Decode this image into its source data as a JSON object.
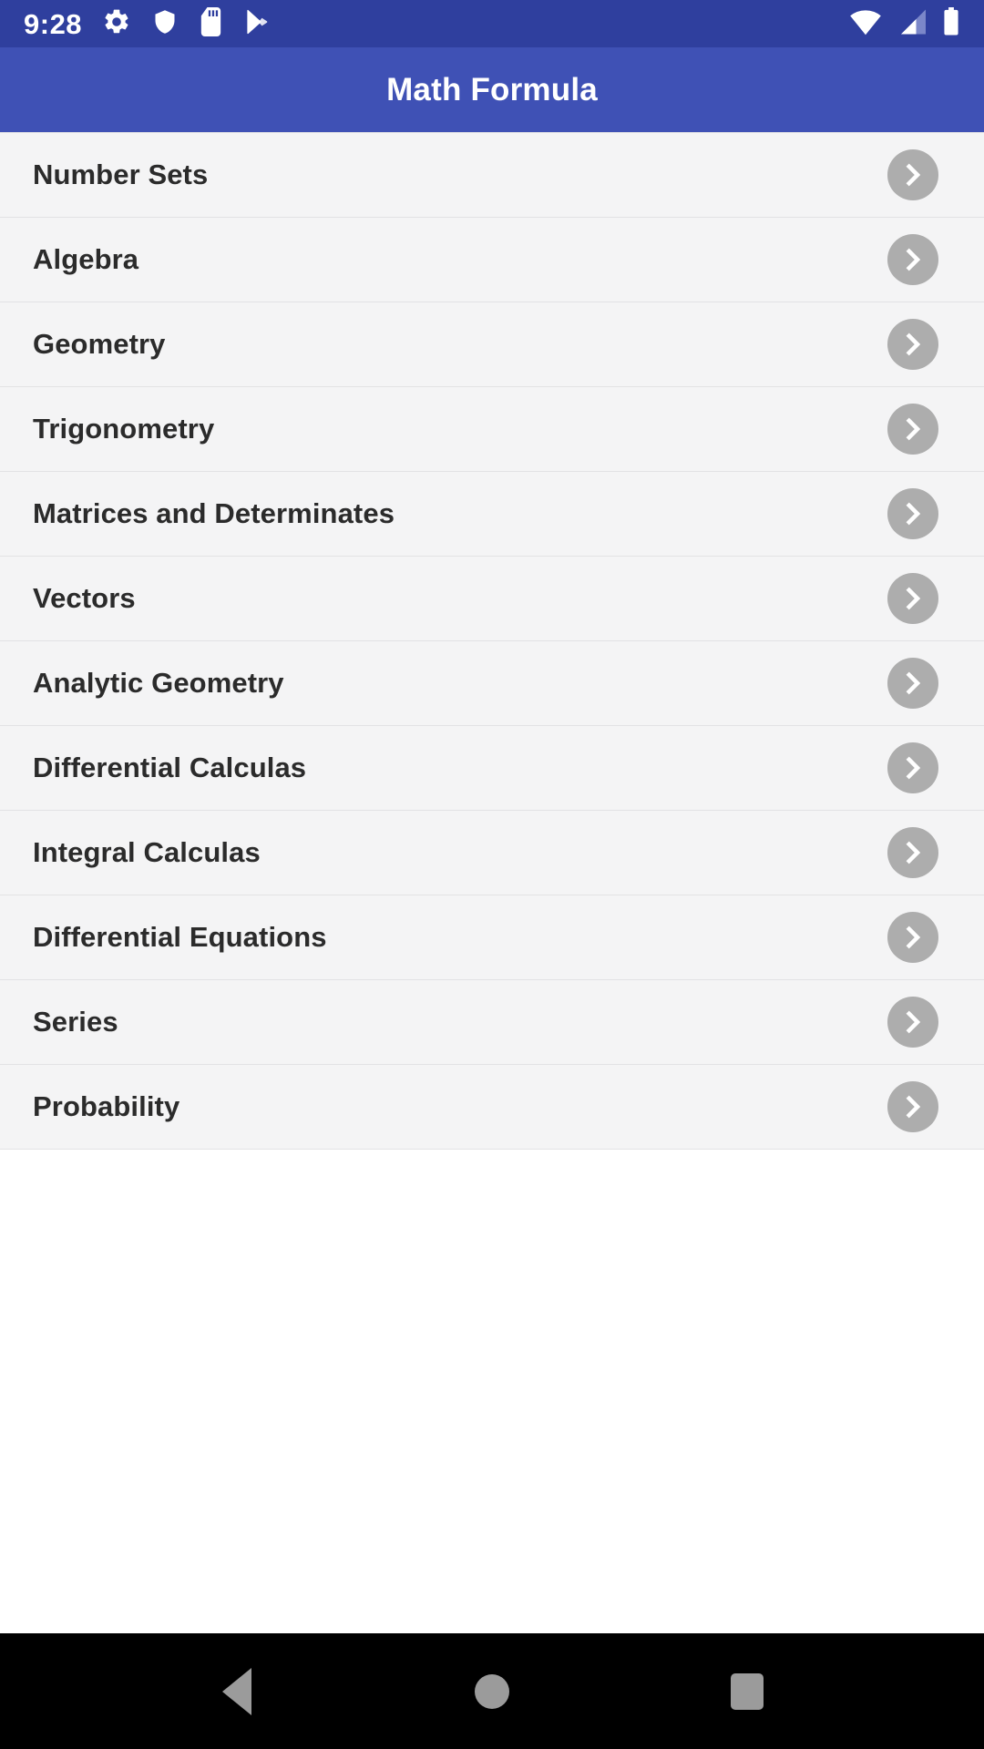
{
  "status_bar": {
    "time": "9:28",
    "background_color": "#2f3f9e",
    "left_icons": [
      {
        "name": "gear-icon",
        "label": "Settings"
      },
      {
        "name": "shield-icon",
        "label": "Security"
      },
      {
        "name": "sd-card-icon",
        "label": "SD Card"
      },
      {
        "name": "play-store-icon",
        "label": "Play Store"
      }
    ],
    "right_icons": [
      {
        "name": "wifi-icon",
        "label": "Wi-Fi"
      },
      {
        "name": "cellular-signal-icon",
        "label": "Cellular signal"
      },
      {
        "name": "battery-icon",
        "label": "Battery"
      }
    ]
  },
  "app_bar": {
    "title": "Math Formula",
    "background_color": "#3f51b5",
    "title_color": "#ffffff"
  },
  "list": {
    "row_background_color": "#f4f4f5",
    "divider_color": "#e2e2e4",
    "chevron_color": "#adadad",
    "items": [
      {
        "label": "Number Sets"
      },
      {
        "label": "Algebra"
      },
      {
        "label": "Geometry"
      },
      {
        "label": "Trigonometry"
      },
      {
        "label": "Matrices and Determinates"
      },
      {
        "label": "Vectors"
      },
      {
        "label": "Analytic Geometry"
      },
      {
        "label": "Differential Calculas"
      },
      {
        "label": "Integral Calculas"
      },
      {
        "label": "Differential Equations"
      },
      {
        "label": "Series"
      },
      {
        "label": "Probability"
      }
    ]
  },
  "nav_bar": {
    "background_color": "#000000",
    "icon_color": "#9b9b9b",
    "buttons": [
      {
        "name": "back-button",
        "label": "Back"
      },
      {
        "name": "home-button",
        "label": "Home"
      },
      {
        "name": "recents-button",
        "label": "Recents"
      }
    ]
  }
}
